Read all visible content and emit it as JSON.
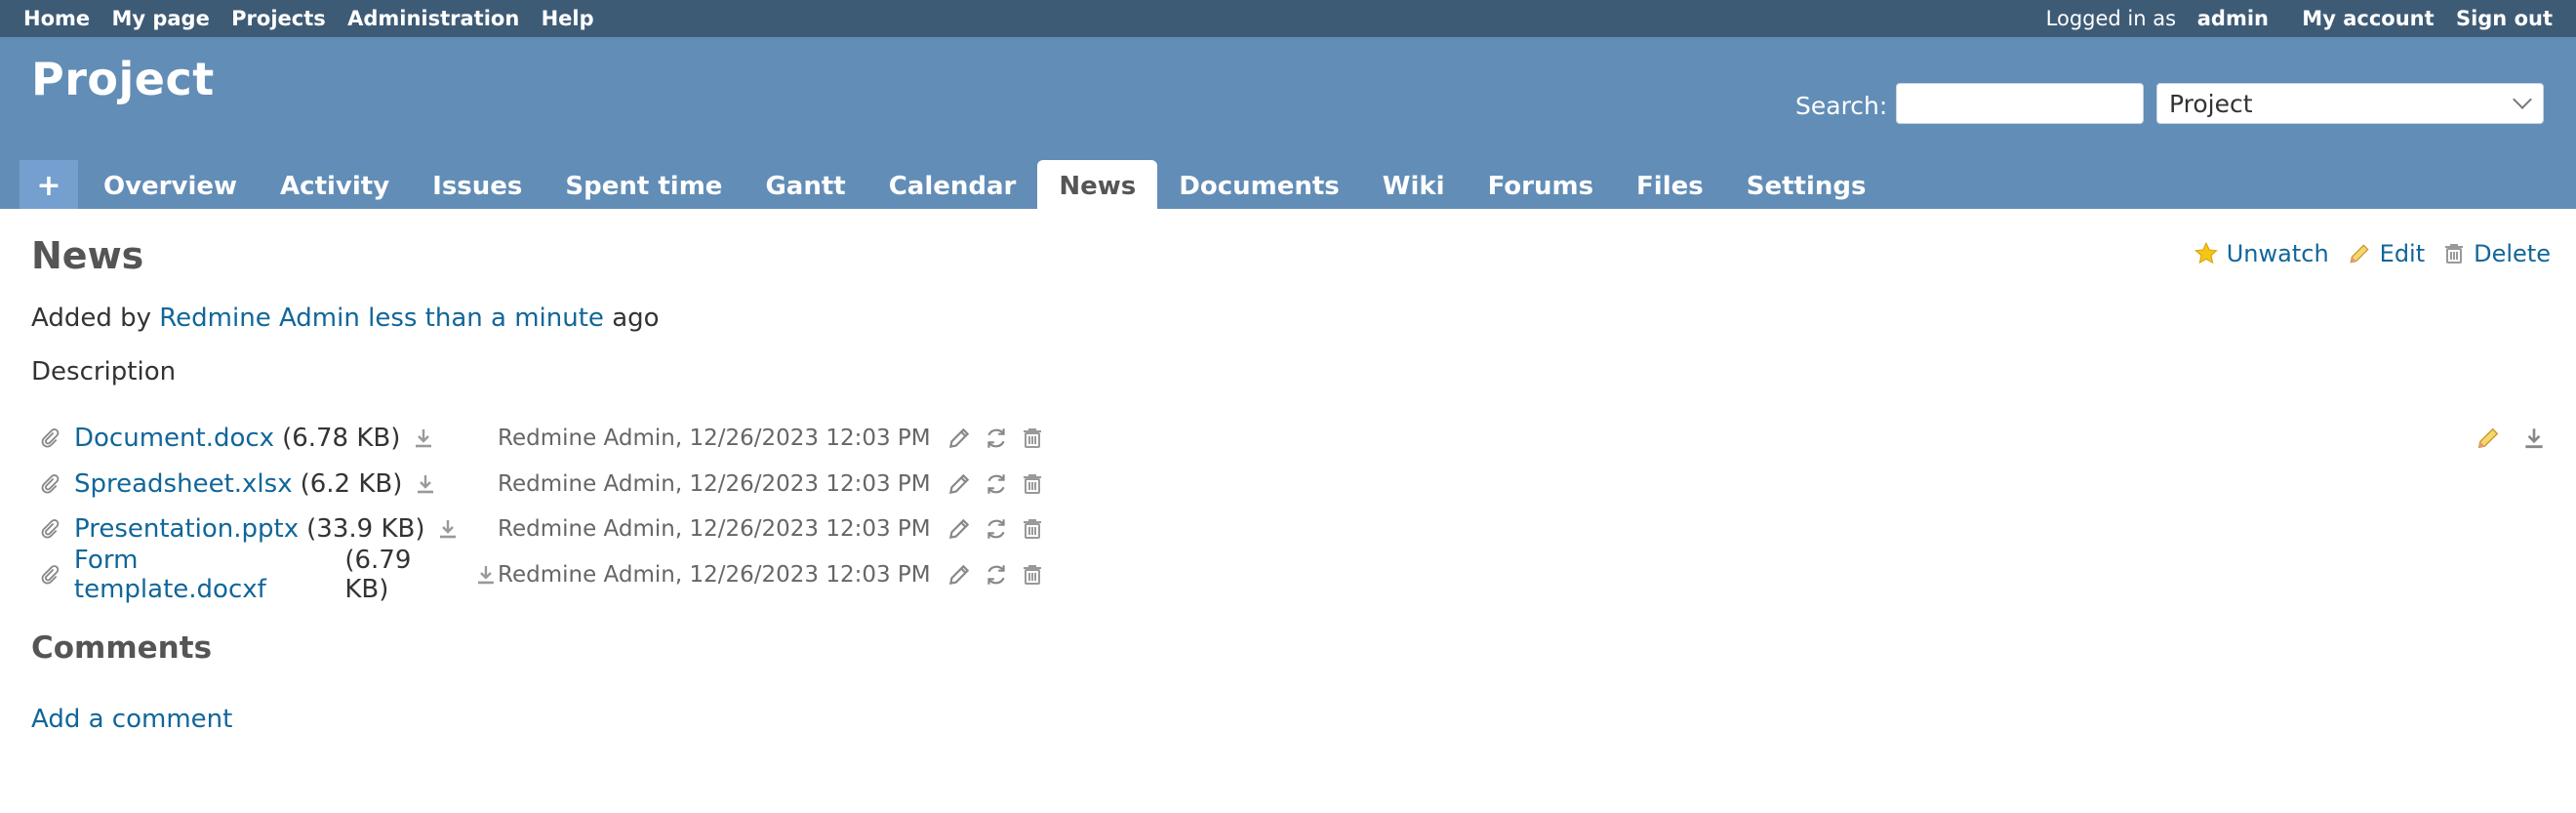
{
  "top_menu": {
    "left": [
      "Home",
      "My page",
      "Projects",
      "Administration",
      "Help"
    ],
    "logged_in_prefix": "Logged in as",
    "user": "admin",
    "my_account": "My account",
    "sign_out": "Sign out"
  },
  "header": {
    "project_title": "Project",
    "search_label": "Search:",
    "search_value": "",
    "scope_selected": "Project"
  },
  "tabs": {
    "plus": "+",
    "items": [
      "Overview",
      "Activity",
      "Issues",
      "Spent time",
      "Gantt",
      "Calendar",
      "News",
      "Documents",
      "Wiki",
      "Forums",
      "Files",
      "Settings"
    ],
    "selected": "News"
  },
  "news": {
    "title": "News",
    "actions": {
      "unwatch": "Unwatch",
      "edit": "Edit",
      "delete": "Delete"
    },
    "added_by_prefix": "Added by",
    "author": "Redmine Admin",
    "time": "less than a minute",
    "ago": "ago",
    "description_label": "Description"
  },
  "attachments": [
    {
      "name": "Document.docx",
      "size": "(6.78 KB)",
      "meta": "Redmine Admin, 12/26/2023 12:03 PM"
    },
    {
      "name": "Spreadsheet.xlsx",
      "size": "(6.2 KB)",
      "meta": "Redmine Admin, 12/26/2023 12:03 PM"
    },
    {
      "name": "Presentation.pptx",
      "size": "(33.9 KB)",
      "meta": "Redmine Admin, 12/26/2023 12:03 PM"
    },
    {
      "name": "Form template.docxf",
      "size": "(6.79 KB)",
      "meta": "Redmine Admin, 12/26/2023 12:03 PM"
    }
  ],
  "comments": {
    "title": "Comments",
    "add_comment": "Add a comment"
  },
  "colors": {
    "top_bar": "#3e5b76",
    "header": "#628db6",
    "link": "#169",
    "plus_tab": "#759fcf"
  },
  "icons": [
    "paperclip-icon",
    "download-icon",
    "pencil-icon",
    "refresh-icon",
    "trash-icon",
    "star-icon"
  ]
}
